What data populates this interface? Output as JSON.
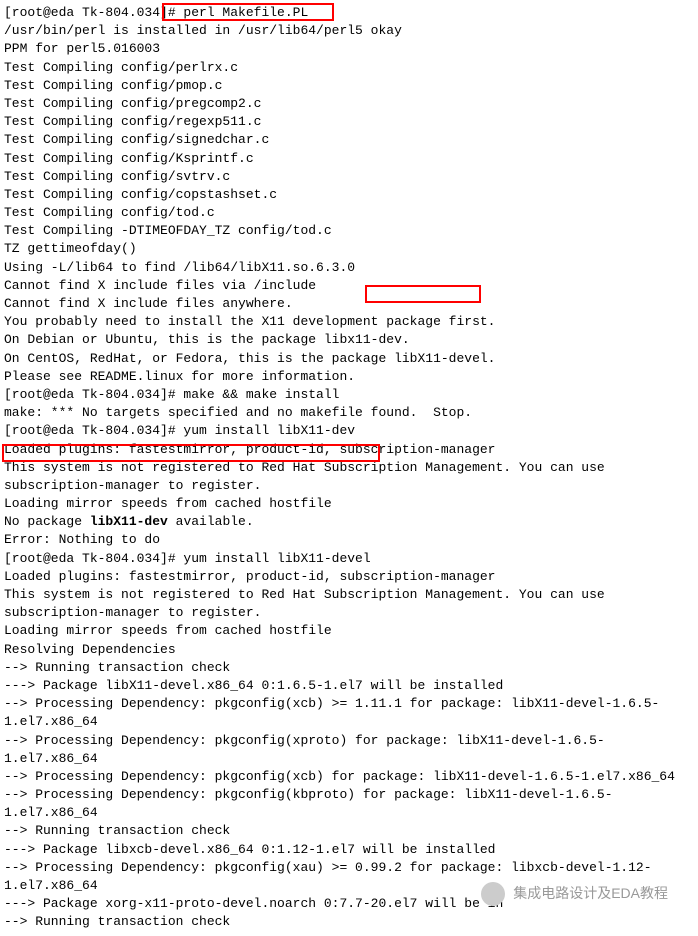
{
  "lines": [
    "[root@eda Tk-804.034]# perl Makefile.PL",
    "/usr/bin/perl is installed in /usr/lib64/perl5 okay",
    "PPM for perl5.016003",
    "Test Compiling config/perlrx.c",
    "Test Compiling config/pmop.c",
    "Test Compiling config/pregcomp2.c",
    "Test Compiling config/regexp511.c",
    "Test Compiling config/signedchar.c",
    "Test Compiling config/Ksprintf.c",
    "Test Compiling config/svtrv.c",
    "Test Compiling config/copstashset.c",
    "Test Compiling config/tod.c",
    "Test Compiling -DTIMEOFDAY_TZ config/tod.c",
    "TZ gettimeofday()",
    "Using -L/lib64 to find /lib64/libX11.so.6.3.0",
    "Cannot find X include files via /include",
    "Cannot find X include files anywhere.",
    "You probably need to install the X11 development package first.",
    "On Debian or Ubuntu, this is the package libx11-dev.",
    "On CentOS, RedHat, or Fedora, this is the package libX11-devel.",
    "Please see README.linux for more information.",
    "[root@eda Tk-804.034]# make && make install",
    "make: *** No targets specified and no makefile found.  Stop.",
    "[root@eda Tk-804.034]# yum install libX11-dev",
    "Loaded plugins: fastestmirror, product-id, subscription-manager",
    "This system is not registered to Red Hat Subscription Management. You can use subscription-manager to register.",
    "Loading mirror speeds from cached hostfile",
    "No package libX11-dev available.",
    "Error: Nothing to do",
    "[root@eda Tk-804.034]# yum install libX11-devel",
    "Loaded plugins: fastestmirror, product-id, subscription-manager",
    "This system is not registered to Red Hat Subscription Management. You can use subscription-manager to register.",
    "Loading mirror speeds from cached hostfile",
    "Resolving Dependencies",
    "--> Running transaction check",
    "---> Package libX11-devel.x86_64 0:1.6.5-1.el7 will be installed",
    "--> Processing Dependency: pkgconfig(xcb) >= 1.11.1 for package: libX11-devel-1.6.5-1.el7.x86_64",
    "--> Processing Dependency: pkgconfig(xproto) for package: libX11-devel-1.6.5-1.el7.x86_64",
    "--> Processing Dependency: pkgconfig(xcb) for package: libX11-devel-1.6.5-1.el7.x86_64",
    "--> Processing Dependency: pkgconfig(kbproto) for package: libX11-devel-1.6.5-1.el7.x86_64",
    "--> Running transaction check",
    "---> Package libxcb-devel.x86_64 0:1.12-1.el7 will be installed",
    "--> Processing Dependency: pkgconfig(xau) >= 0.99.2 for package: libxcb-devel-1.12-1.el7.x86_64",
    "---> Package xorg-x11-proto-devel.noarch 0:7.7-20.el7 will be in",
    "--> Running transaction check"
  ],
  "bold_segments": {
    "27": "libX11-dev"
  },
  "watermark": "集成电路设计及EDA教程",
  "highlights": [
    {
      "text": "# perl Makefile.PL",
      "line": 0
    },
    {
      "text": "libX11-devel.",
      "line": 19
    },
    {
      "text": "[root@eda Tk-804.034]# yum install libX11-devel",
      "line": 29
    }
  ]
}
